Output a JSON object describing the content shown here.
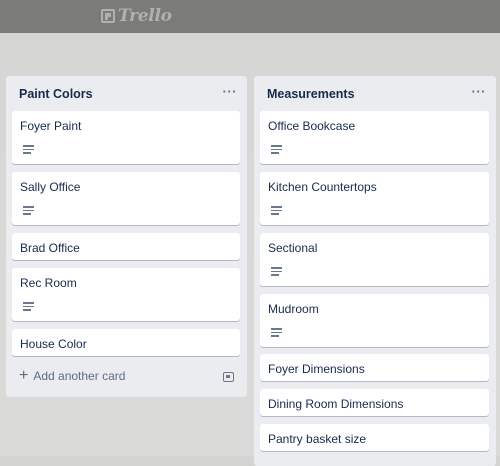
{
  "app": {
    "logo_text": "Trello"
  },
  "lists": [
    {
      "title": "Paint Colors",
      "menu_label": "···",
      "cards": [
        {
          "title": "Foyer Paint",
          "has_description": true
        },
        {
          "title": "Sally Office",
          "has_description": true
        },
        {
          "title": "Brad Office",
          "has_description": false
        },
        {
          "title": "Rec Room",
          "has_description": true
        },
        {
          "title": "House Color",
          "has_description": false
        }
      ],
      "add_card_label": "Add another card",
      "add_card_icon": "plus-icon",
      "template_icon": "card-template-icon"
    },
    {
      "title": "Measurements",
      "menu_label": "···",
      "cards": [
        {
          "title": "Office Bookcase",
          "has_description": true
        },
        {
          "title": "Kitchen Countertops",
          "has_description": true
        },
        {
          "title": "Sectional",
          "has_description": true
        },
        {
          "title": "Mudroom",
          "has_description": true
        },
        {
          "title": "Foyer Dimensions",
          "has_description": false
        },
        {
          "title": "Dining Room Dimensions",
          "has_description": false
        },
        {
          "title": "Pantry basket size",
          "has_description": false
        }
      ]
    }
  ],
  "colors": {
    "header_bar": "#7b7b79",
    "board_background": "#d8d8d6",
    "list_background": "#ebecf0",
    "card_background": "#ffffff",
    "title_text": "#172b4d",
    "muted_text": "#5e6c84"
  }
}
